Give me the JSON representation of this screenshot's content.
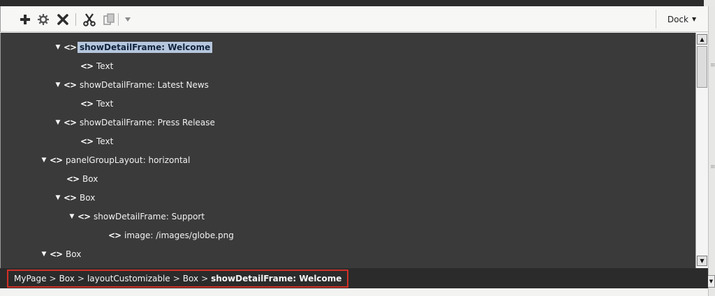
{
  "toolbar": {
    "add_icon": "plus-icon",
    "settings_icon": "gear-icon",
    "delete_icon": "x-icon",
    "cut_icon": "scissors-icon",
    "copy_icon": "copy-icon",
    "more_icon": "chevron-down-icon",
    "dock_label": "Dock"
  },
  "tree": {
    "nodes": [
      {
        "label": "showDetailFrame: Welcome",
        "expanded": true,
        "selected": true
      },
      {
        "label": "Text"
      },
      {
        "label": "showDetailFrame: Latest News",
        "expanded": true
      },
      {
        "label": "Text"
      },
      {
        "label": "showDetailFrame: Press Release",
        "expanded": true
      },
      {
        "label": "Text"
      },
      {
        "label": "panelGroupLayout: horizontal",
        "expanded": true
      },
      {
        "label": "Box"
      },
      {
        "label": "Box",
        "expanded": true
      },
      {
        "label": "showDetailFrame: Support",
        "expanded": true
      },
      {
        "label": "image: /images/globe.png"
      },
      {
        "label": "Box",
        "expanded": true
      }
    ]
  },
  "breadcrumb": {
    "items": [
      "MyPage",
      "Box",
      "layoutCustomizable",
      "Box"
    ],
    "current": "showDetailFrame: Welcome",
    "separator": ">"
  },
  "colors": {
    "tree_bg": "#3a3a3a",
    "selection_bg": "#b6c7dd",
    "breadcrumb_highlight": "#d22f27"
  }
}
